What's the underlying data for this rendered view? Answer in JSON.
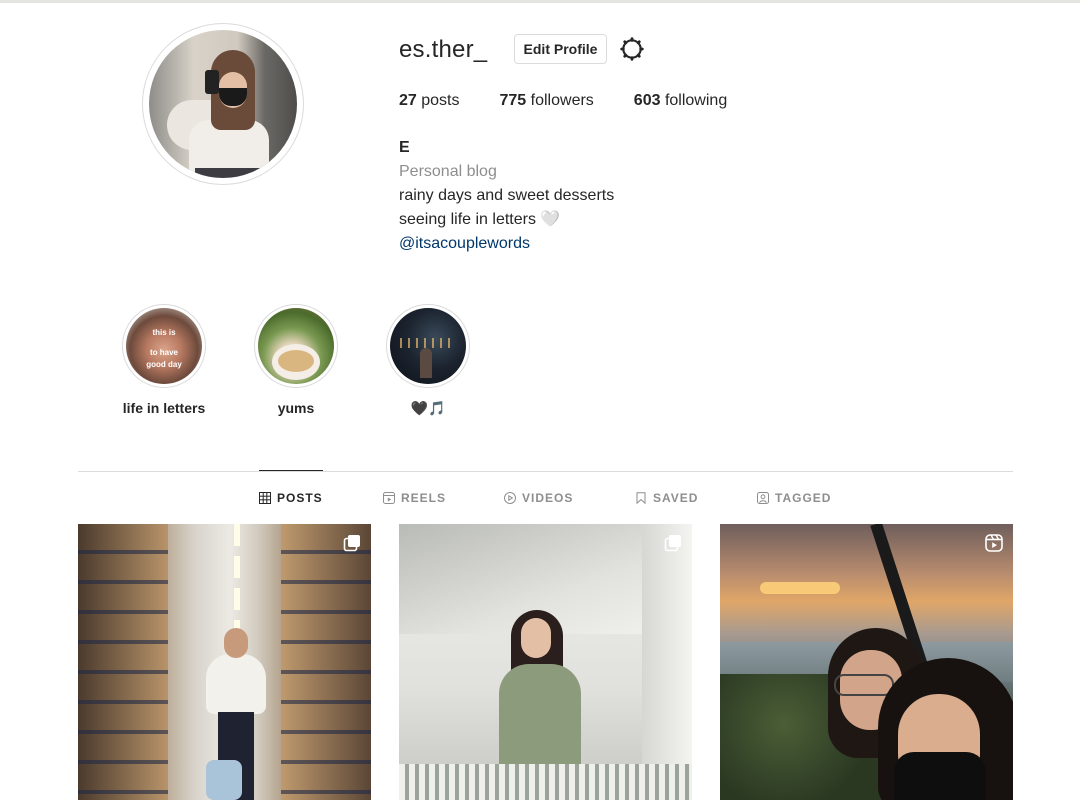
{
  "profile": {
    "username": "es.ther_",
    "edit_label": "Edit Profile",
    "stats": [
      {
        "value": "27",
        "label": "posts"
      },
      {
        "value": "775",
        "label": "followers"
      },
      {
        "value": "603",
        "label": "following"
      }
    ],
    "bio": {
      "name": "E",
      "category": "Personal blog",
      "lines": [
        "rainy days and sweet desserts",
        "seeing life in letters 🤍"
      ],
      "link": "@itsacouplewords"
    }
  },
  "highlights": [
    {
      "label": "life in letters",
      "thumb_text": [
        "this is",
        "to have",
        "good day"
      ]
    },
    {
      "label": "yums"
    },
    {
      "label": "🖤🎵"
    }
  ],
  "tabs": [
    {
      "label": "POSTS",
      "icon": "grid-icon",
      "active": true
    },
    {
      "label": "REELS",
      "icon": "reels-icon",
      "active": false
    },
    {
      "label": "VIDEOS",
      "icon": "play-icon",
      "active": false
    },
    {
      "label": "SAVED",
      "icon": "bookmark-icon",
      "active": false
    },
    {
      "label": "TAGGED",
      "icon": "tag-user-icon",
      "active": false
    }
  ],
  "posts": [
    {
      "badge": "carousel-icon"
    },
    {
      "badge": "carousel-icon"
    },
    {
      "badge": "reel-icon"
    }
  ],
  "colors": {
    "text": "#262626",
    "muted": "#8e8e8e",
    "link": "#00376b",
    "border": "#dbdbdb"
  }
}
